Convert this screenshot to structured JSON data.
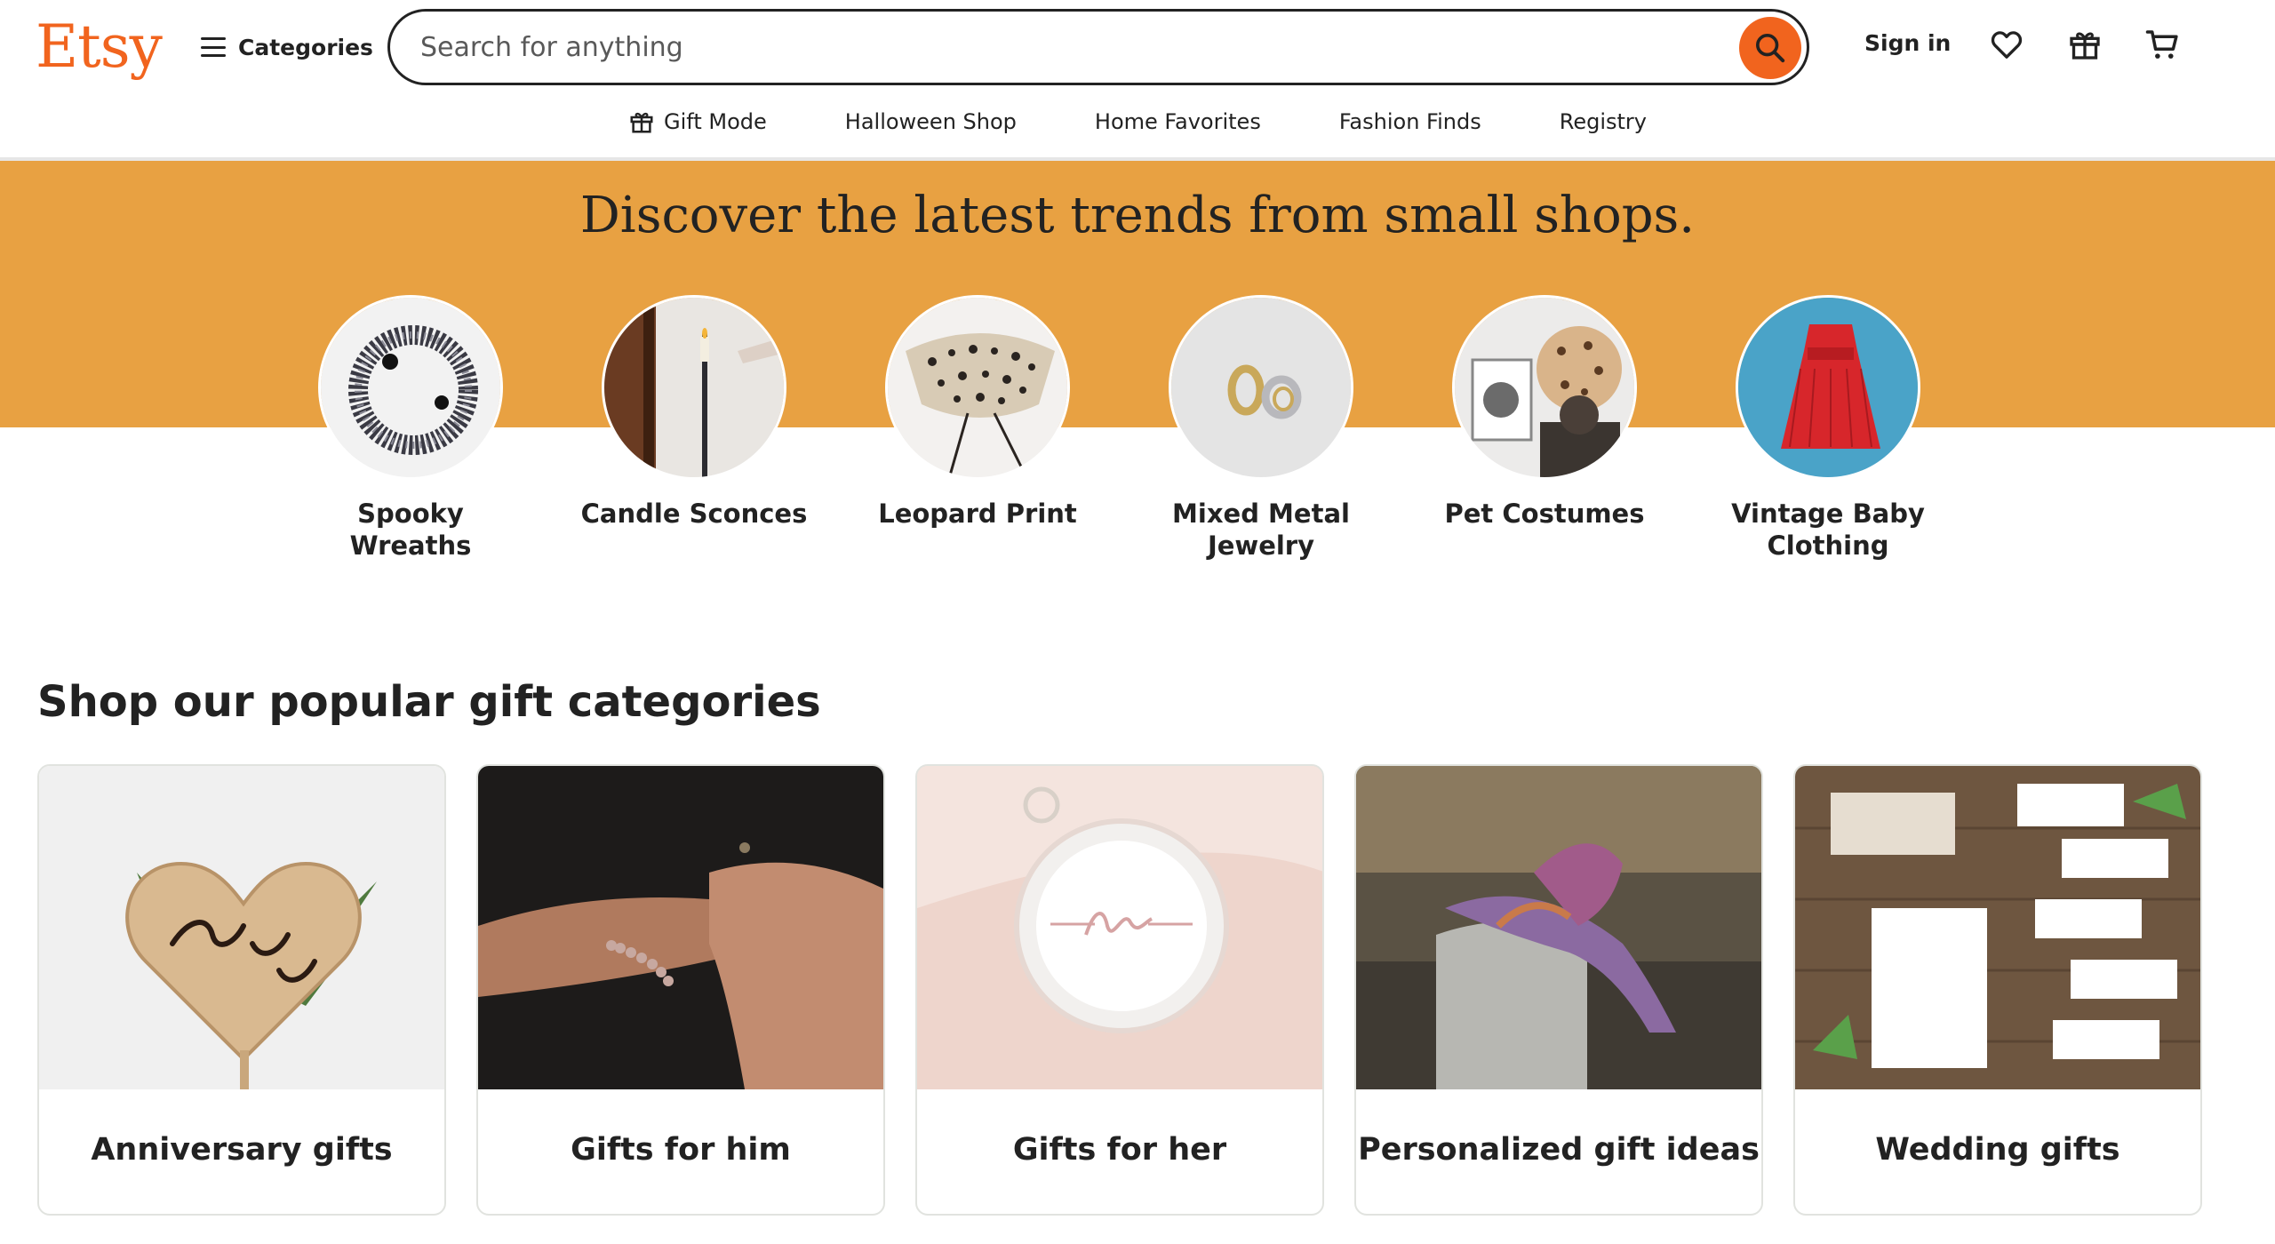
{
  "header": {
    "logo": "Etsy",
    "categories_label": "Categories",
    "search_placeholder": "Search for anything",
    "sign_in": "Sign in"
  },
  "subnav": {
    "items": [
      {
        "label": "Gift Mode",
        "icon": "gift-icon"
      },
      {
        "label": "Halloween Shop"
      },
      {
        "label": "Home Favorites"
      },
      {
        "label": "Fashion Finds"
      },
      {
        "label": "Registry"
      }
    ]
  },
  "banner": {
    "title": "Discover the latest trends from small shops.",
    "trends": [
      {
        "label": "Spooky Wreaths"
      },
      {
        "label": "Candle Sconces"
      },
      {
        "label": "Leopard Print"
      },
      {
        "label": "Mixed Metal Jewelry"
      },
      {
        "label": "Pet Costumes"
      },
      {
        "label": "Vintage Baby Clothing"
      }
    ]
  },
  "gifts": {
    "title": "Shop our popular gift categories",
    "cards": [
      {
        "label": "Anniversary gifts"
      },
      {
        "label": "Gifts for him"
      },
      {
        "label": "Gifts for her"
      },
      {
        "label": "Personalized gift ideas"
      },
      {
        "label": "Wedding gifts"
      }
    ]
  },
  "colors": {
    "brand": "#f1641e",
    "banner": "#e8a142",
    "text": "#222222"
  }
}
